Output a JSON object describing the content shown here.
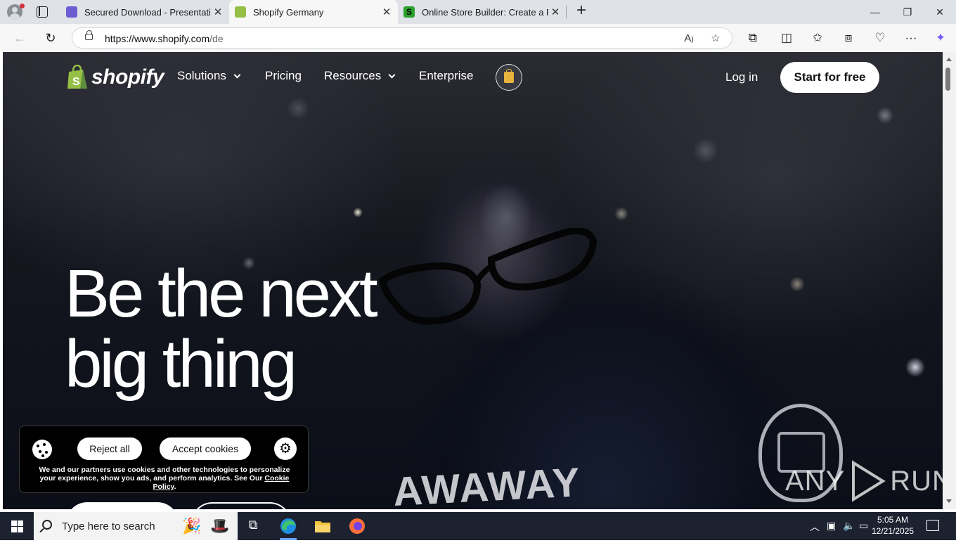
{
  "browser": {
    "tabs": [
      {
        "title": "Secured Download - Presentation",
        "favicon_color": "#6c5dd3",
        "close": "✕"
      },
      {
        "title": "Shopify Germany",
        "favicon_color": "#95bf47",
        "close": "✕",
        "active": true
      },
      {
        "title": "Online Store Builder: Create a Free",
        "favicon_color": "#2aa02a",
        "close": "✕"
      }
    ],
    "new_tab": "+",
    "window_controls": {
      "minimize": "—",
      "maximize": "❐",
      "close": "✕"
    },
    "address": {
      "scheme_host": "https://www.shopify.com",
      "path": "/de"
    }
  },
  "site": {
    "logo_text": "shopify",
    "nav": {
      "solutions": "Solutions",
      "pricing": "Pricing",
      "resources": "Resources",
      "enterprise": "Enterprise"
    },
    "login": "Log in",
    "cta": "Start for free",
    "hero": {
      "line1": "Be the next",
      "line2": "big thing"
    },
    "hoodie_text": "AWAWAY"
  },
  "cookie_banner": {
    "reject": "Reject all",
    "accept": "Accept cookies",
    "text": "We and our partners use cookies and other technologies to personalize your experience, show you ads, and perform analytics. See Our",
    "link": "Cookie Policy",
    "text_end": "."
  },
  "watermark": {
    "left": "ANY",
    "right": "RUN"
  },
  "taskbar": {
    "search_placeholder": "Type here to search",
    "time": "5:05 AM",
    "date": "12/21/2025"
  },
  "colors": {
    "shopify_green": "#95bf47",
    "background": "#0c0f18",
    "taskbar": "#1c2230"
  }
}
